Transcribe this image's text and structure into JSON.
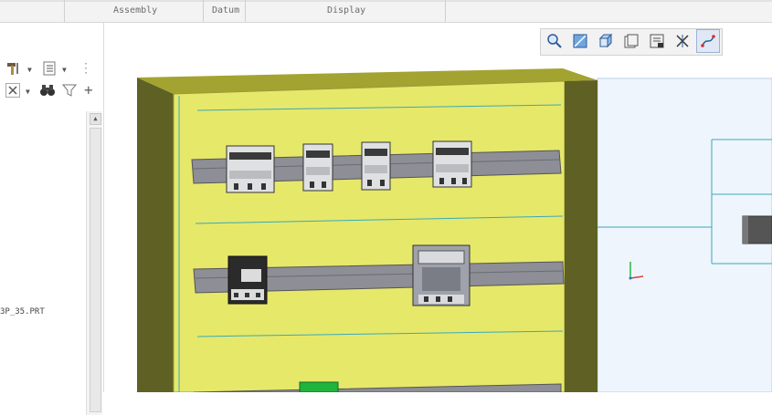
{
  "ribbon": {
    "groups": [
      "Assembly",
      "Datum",
      "Display"
    ]
  },
  "model_tree": {
    "file_label": "3P_35.PRT"
  },
  "icons": {
    "hammer": "hammer-icon",
    "list": "list-icon",
    "close": "close-icon",
    "binoculars": "binoculars-icon",
    "filter": "filter-icon",
    "add": "add-icon"
  },
  "colors": {
    "panel_face": "#e6e86a",
    "cabinet_side": "#5f6024",
    "rail": "#8e8e96",
    "background_3d": "#eef5fd",
    "grid_line": "#3aa9b7",
    "terminal_green": "#1fb43c"
  }
}
